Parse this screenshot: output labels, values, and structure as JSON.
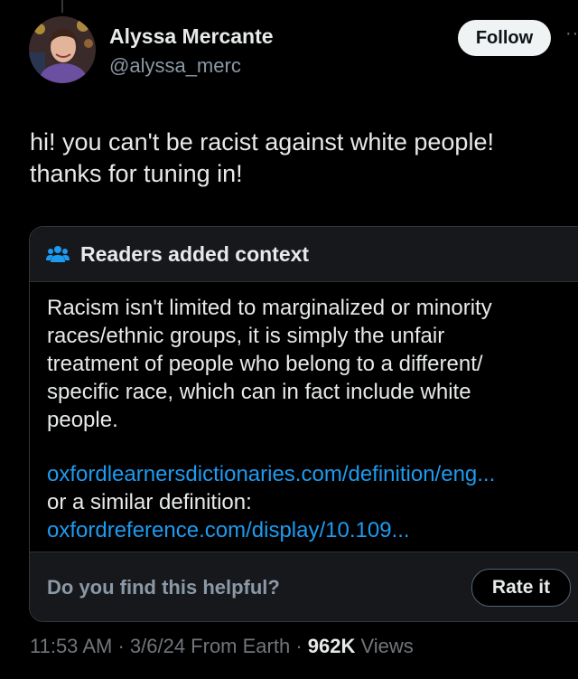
{
  "tweet": {
    "author": {
      "display_name": "Alyssa Mercante",
      "handle": "@alyssa_merc"
    },
    "follow_label": "Follow",
    "more_icon": "more-horizontal-icon",
    "text_lines": [
      "hi! you can't be racist against white people!",
      "thanks for tuning in!"
    ]
  },
  "context_note": {
    "header_icon": "people-icon",
    "title": "Readers added context",
    "body_lines": [
      "Racism isn't limited to marginalized or minority",
      "races/ethnic groups, it is simply the unfair",
      "treatment of people who belong to a different/",
      "specific race, which can in fact include white",
      "people."
    ],
    "link1": "oxfordlearnersdictionaries.com/definition/eng...",
    "mid_text": "or a similar definition:",
    "link2": "oxfordreference.com/display/10.109...",
    "footer_question": "Do you find this helpful?",
    "rate_label": "Rate it"
  },
  "meta": {
    "time": "11:53 AM",
    "sep1": " · ",
    "date": "3/6/24",
    "source": " From Earth",
    "sep2": " · ",
    "views_count": "962K",
    "views_label": " Views"
  },
  "colors": {
    "background": "#000000",
    "link": "#1d9bf0",
    "muted": "#71767b",
    "text": "#e7e9ea"
  }
}
